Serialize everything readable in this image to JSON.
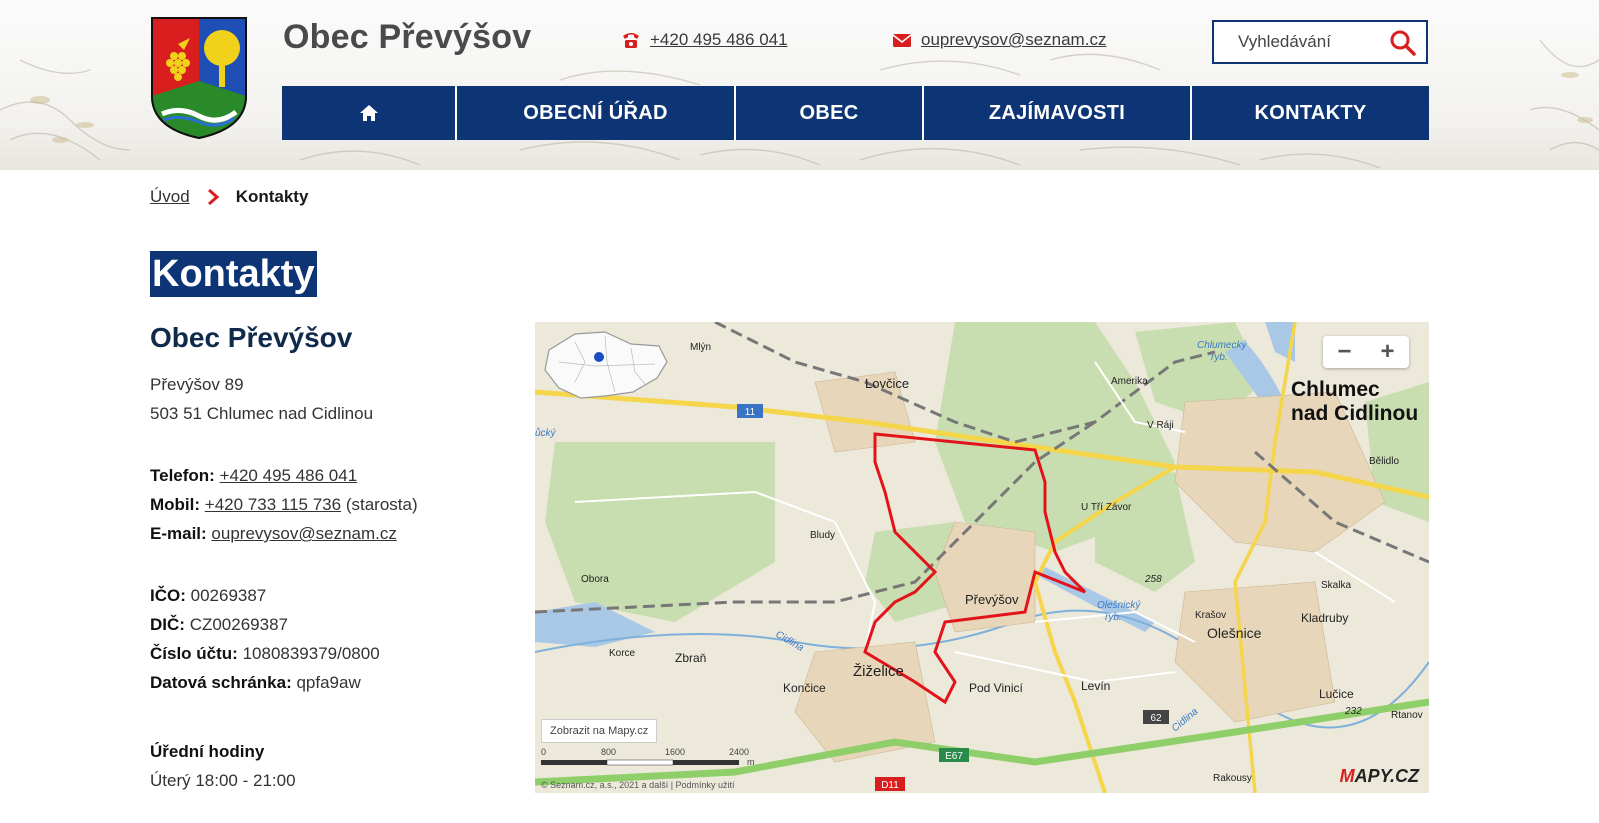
{
  "header": {
    "site_title": "Obec Převýšov",
    "phone": "+420 495 486 041",
    "email": "ouprevysov@seznam.cz",
    "search_placeholder": "Vyhledávání"
  },
  "nav": {
    "home_icon": "home-icon",
    "items": [
      "OBECNÍ ÚŘAD",
      "OBEC",
      "ZAJÍMAVOSTI",
      "KONTAKTY"
    ]
  },
  "breadcrumb": {
    "home": "Úvod",
    "current": "Kontakty"
  },
  "page_title": "Kontakty",
  "org": {
    "name": "Obec Převýšov",
    "address_line1": "Převýšov 89",
    "address_line2": "503 51 Chlumec nad Cidlinou",
    "phone_label": "Telefon:",
    "phone": "+420 495 486 041",
    "mobile_label": "Mobil:",
    "mobile": "+420 733 115 736",
    "mobile_note": "(starosta)",
    "email_label": "E-mail:",
    "email": "ouprevysov@seznam.cz",
    "ico_label": "IČO:",
    "ico": "00269387",
    "dic_label": "DIČ:",
    "dic": "CZ00269387",
    "account_label": "Číslo účtu:",
    "account": "1080839379/0800",
    "databox_label": "Datová schránka:",
    "databox": "qpfa9aw",
    "hours_title": "Úřední hodiny",
    "hours": "Úterý 18:00 - 21:00"
  },
  "map": {
    "zoom_out": "−",
    "zoom_in": "+",
    "show_link": "Zobrazit na Mapy.cz",
    "copyright": "© Seznam.cz, a.s., 2021 a další | Podmínky užití",
    "logo_m": "M",
    "logo_rest": "APY.CZ",
    "scale": [
      "0",
      "800",
      "1600",
      "2400",
      "m"
    ],
    "roads": {
      "r11": "11",
      "e67": "E67",
      "d11": "D11",
      "r62": "62"
    },
    "places": {
      "lovcice": "Lovčice",
      "mlyn": "Mlýn",
      "amerika": "Amerika",
      "vraji": "V Ráji",
      "chlumec": "Chlumec",
      "chlumec2": "nad Cidlinou",
      "chlumecky": "Chlumecký",
      "ryb1": "ryb.",
      "bélidlo": "Bělidlo",
      "utrizavor": "U Tří Závor",
      "bludy": "Bludy",
      "obora": "Obora",
      "prevysov": "Převýšov",
      "olesnicky": "Olešnický",
      "ryb2": "ryb.",
      "h258": "258",
      "skalka": "Skalka",
      "krasov": "Krašov",
      "olesnice": "Olešnice",
      "kladruby": "Kladruby",
      "korce": "Korce",
      "zbran": "Zbraň",
      "zizelice": "Žiželice",
      "koncice": "Končice",
      "podvinici": "Pod Vinicí",
      "levin": "Levín",
      "lucice": "Lučice",
      "h232": "232",
      "rtanov": "Rtanov",
      "rakousy": "Rakousy",
      "cidlina": "Cidlina",
      "cidlina2": "Cidlina",
      "ucky": "ůcký"
    }
  },
  "colors": {
    "brand_navy": "#0d3575",
    "accent_red": "#d81e1e",
    "route_red": "#e3131b"
  }
}
